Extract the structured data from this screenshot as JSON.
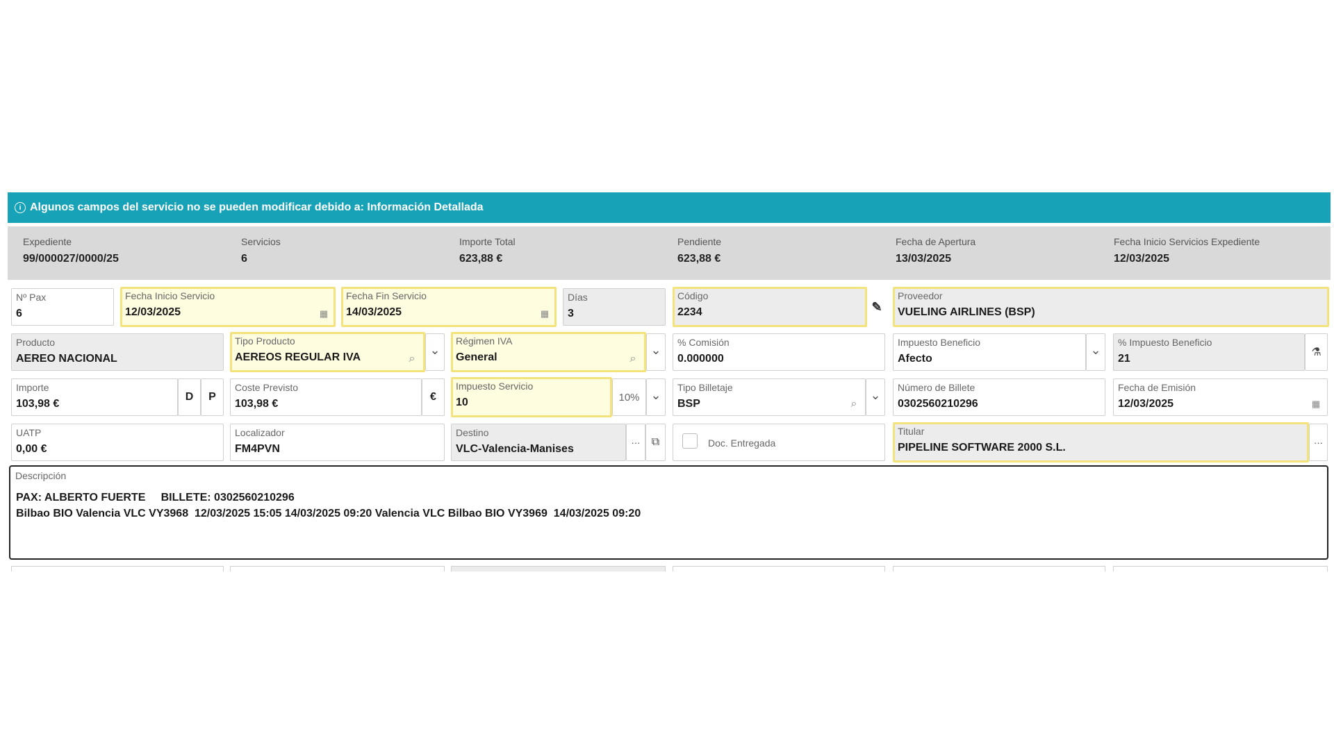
{
  "banner": {
    "icon": "info-icon",
    "text": "Algunos campos del servicio no se pueden modificar debido a: Información Detallada"
  },
  "summary": [
    {
      "label": "Expediente",
      "value": "99/000027/0000/25"
    },
    {
      "label": "Servicios",
      "value": "6"
    },
    {
      "label": "Importe Total",
      "value": "623,88 €"
    },
    {
      "label": "Pendiente",
      "value": "623,88 €"
    },
    {
      "label": "Fecha de Apertura",
      "value": "13/03/2025"
    },
    {
      "label": "Fecha Inicio Servicios Expediente",
      "value": "12/03/2025"
    }
  ],
  "row1": {
    "npax": {
      "label": "Nº Pax",
      "value": "6"
    },
    "fecha_inicio": {
      "label": "Fecha Inicio Servicio",
      "value": "12/03/2025"
    },
    "fecha_fin": {
      "label": "Fecha Fin Servicio",
      "value": "14/03/2025"
    },
    "dias": {
      "label": "Días",
      "value": "3"
    },
    "codigo": {
      "label": "Código",
      "value": "2234"
    },
    "proveedor": {
      "label": "Proveedor",
      "value": "VUELING AIRLINES  (BSP)"
    }
  },
  "row2": {
    "producto": {
      "label": "Producto",
      "value": "AEREO NACIONAL"
    },
    "tipo_producto": {
      "label": "Tipo Producto",
      "value": "AEREOS REGULAR IVA"
    },
    "regimen_iva": {
      "label": "Régimen IVA",
      "value": "General"
    },
    "comision": {
      "label": "% Comisión",
      "value": "0.000000"
    },
    "impuesto_beneficio": {
      "label": "Impuesto Beneficio",
      "value": "Afecto"
    },
    "pct_impuesto_beneficio": {
      "label": "% Impuesto Beneficio",
      "value": "21"
    }
  },
  "row3": {
    "importe": {
      "label": "Importe",
      "value": "103,98 €",
      "btn_d": "D",
      "btn_p": "P"
    },
    "coste_previsto": {
      "label": "Coste Previsto",
      "value": "103,98 €",
      "currency": "€"
    },
    "impuesto_servicio": {
      "label": "Impuesto Servicio",
      "value": "10",
      "pct": "10%"
    },
    "tipo_billetaje": {
      "label": "Tipo Billetaje",
      "value": "BSP"
    },
    "numero_billete": {
      "label": "Número de Billete",
      "value": "0302560210296"
    },
    "fecha_emision": {
      "label": "Fecha de Emisión",
      "value": "12/03/2025"
    }
  },
  "row4": {
    "uatp": {
      "label": "UATP",
      "value": "0,00 €"
    },
    "localizador": {
      "label": "Localizador",
      "value": "FM4PVN"
    },
    "destino": {
      "label": "Destino",
      "value": "VLC-Valencia-Manises"
    },
    "doc_entregada": {
      "label": "Doc. Entregada",
      "checked": false
    },
    "titular": {
      "label": "Titular",
      "value": "PIPELINE SOFTWARE 2000 S.L."
    }
  },
  "descripcion": {
    "label": "Descripción",
    "line1": "PAX: ALBERTO FUERTE     BILLETE: 0302560210296",
    "line2": "Bilbao BIO Valencia VLC VY3968  12/03/2025 15:05 14/03/2025 09:20 Valencia VLC Bilbao BIO VY3969  14/03/2025 09:20"
  },
  "icons": {
    "calendar": "▦",
    "search": "⌕",
    "chevron": "⌄",
    "edit": "✎",
    "ellipsis": "···",
    "copy": "⧉",
    "flask": "⚗"
  },
  "colors": {
    "banner": "#17a2b8",
    "summary_bg": "#d9d9d9",
    "highlight_border": "#f4e27a",
    "highlight_bg": "#fffde0"
  }
}
